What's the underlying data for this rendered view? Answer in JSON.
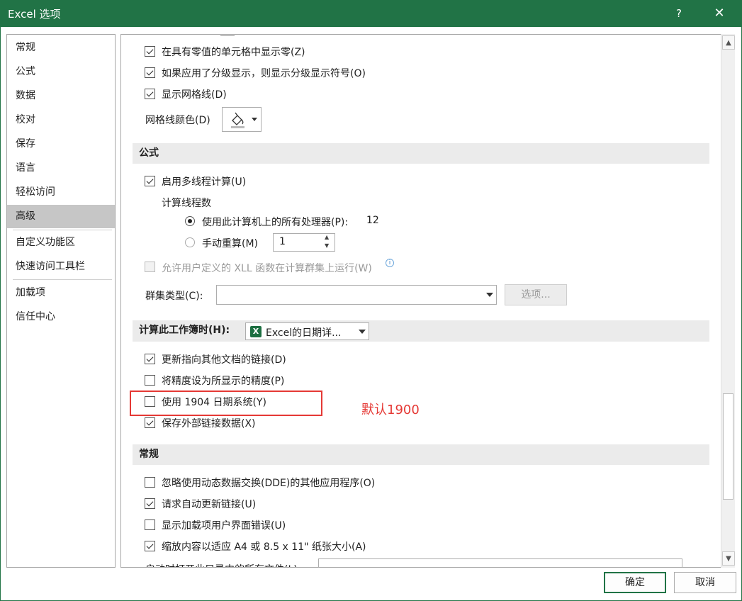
{
  "window": {
    "title": "Excel 选项",
    "help": "?",
    "close": "✕"
  },
  "sidebar": {
    "items": [
      {
        "label": "常规"
      },
      {
        "label": "公式"
      },
      {
        "label": "数据"
      },
      {
        "label": "校对"
      },
      {
        "label": "保存"
      },
      {
        "label": "语言"
      },
      {
        "label": "轻松访问"
      },
      {
        "label": "高级",
        "selected": true
      },
      {
        "label": "自定义功能区"
      },
      {
        "label": "快速访问工具栏"
      },
      {
        "label": "加载项"
      },
      {
        "label": "信任中心"
      }
    ]
  },
  "display": {
    "show_zero": {
      "label": "在具有零值的单元格中显示零(Z)",
      "checked": true
    },
    "show_outline": {
      "label": "如果应用了分级显示，则显示分级显示符号(O)",
      "checked": true
    },
    "show_gridlines": {
      "label": "显示网格线(D)",
      "checked": true
    },
    "gridline_color_label": "网格线颜色(D)",
    "gridline_color_icon": "paint-bucket-icon"
  },
  "formulas": {
    "header": "公式",
    "multithread": {
      "label": "启用多线程计算(U)",
      "checked": true
    },
    "threads_label": "计算线程数",
    "use_all": {
      "label": "使用此计算机上的所有处理器(P):",
      "value": "12",
      "selected": true
    },
    "manual": {
      "label": "手动重算(M)",
      "value": "1",
      "selected": false
    },
    "xll": {
      "label": "允许用户定义的 XLL 函数在计算群集上运行(W)",
      "checked": false,
      "disabled": true
    },
    "cluster_type_label": "群集类型(C):",
    "cluster_type_value": "",
    "options_button": "选项..."
  },
  "workbook": {
    "header": "计算此工作簿时(H):",
    "workbook_select": "Excel的日期详...",
    "update_links": {
      "label": "更新指向其他文档的链接(D)",
      "checked": true
    },
    "precision": {
      "label": "将精度设为所显示的精度(P)",
      "checked": false
    },
    "date1904": {
      "label": "使用 1904 日期系统(Y)",
      "checked": false
    },
    "save_external": {
      "label": "保存外部链接数据(X)",
      "checked": true
    },
    "annotation": "默认1900"
  },
  "general": {
    "header": "常规",
    "ignore_dde": {
      "label": "忽略使用动态数据交换(DDE)的其他应用程序(O)",
      "checked": false
    },
    "auto_update": {
      "label": "请求自动更新链接(U)",
      "checked": true
    },
    "addin_errors": {
      "label": "显示加载项用户界面错误(U)",
      "checked": false
    },
    "scale_a4": {
      "label": "缩放内容以适应 A4 或 8.5 x 11\" 纸张大小(A)",
      "checked": true
    },
    "startup_label": "启动时打开此目录中的所有文件(L):"
  },
  "buttons": {
    "ok": "确定",
    "cancel": "取消"
  }
}
